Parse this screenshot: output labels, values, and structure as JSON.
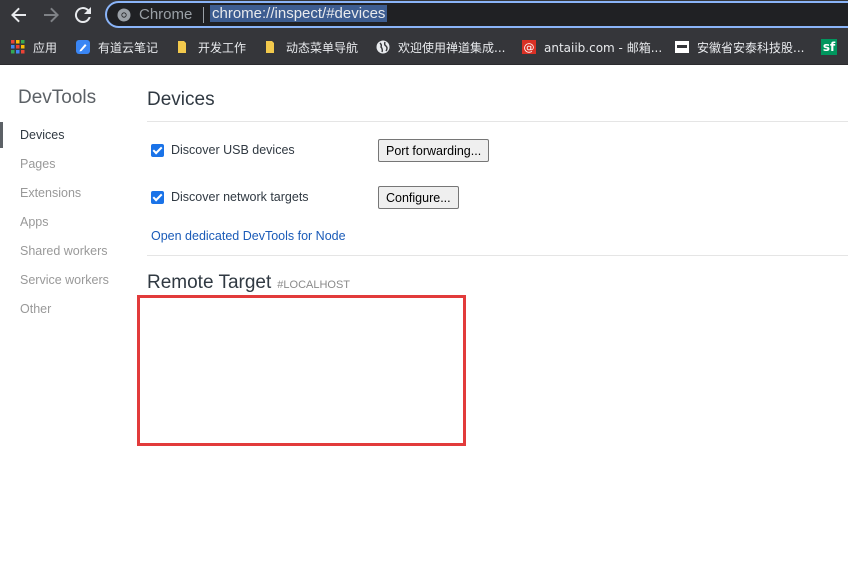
{
  "browser": {
    "omnibox_label": "Chrome",
    "url": "chrome://inspect/#devices"
  },
  "bookmarks": [
    {
      "label": "应用",
      "icon": "apps-grid-icon"
    },
    {
      "label": "有道云笔记",
      "icon": "youdao-note-icon"
    },
    {
      "label": "开发工作",
      "icon": "folder-icon"
    },
    {
      "label": "动态菜单导航",
      "icon": "folder-icon"
    },
    {
      "label": "欢迎使用禅道集成...",
      "icon": "globe-icon"
    },
    {
      "label": "antaiib.com - 邮箱...",
      "icon": "mail-at-icon"
    },
    {
      "label": "安徽省安泰科技股...",
      "icon": "company-logo-icon"
    },
    {
      "label": "sf",
      "icon": "sf-logo-icon"
    }
  ],
  "sidebar": {
    "title": "DevTools",
    "items": [
      {
        "label": "Devices",
        "active": true
      },
      {
        "label": "Pages"
      },
      {
        "label": "Extensions"
      },
      {
        "label": "Apps"
      },
      {
        "label": "Shared workers"
      },
      {
        "label": "Service workers"
      },
      {
        "label": "Other"
      }
    ]
  },
  "main": {
    "title": "Devices",
    "usb": {
      "label": "Discover USB devices",
      "checked": true,
      "button": "Port forwarding..."
    },
    "network": {
      "label": "Discover network targets",
      "checked": true,
      "button": "Configure..."
    },
    "node_link": "Open dedicated DevTools for Node",
    "remote_title": "Remote Target",
    "remote_subtitle": "#LOCALHOST"
  },
  "colors": {
    "accent": "#1a73e8",
    "highlight": "#e23b3b",
    "toolbar": "#35363a"
  }
}
